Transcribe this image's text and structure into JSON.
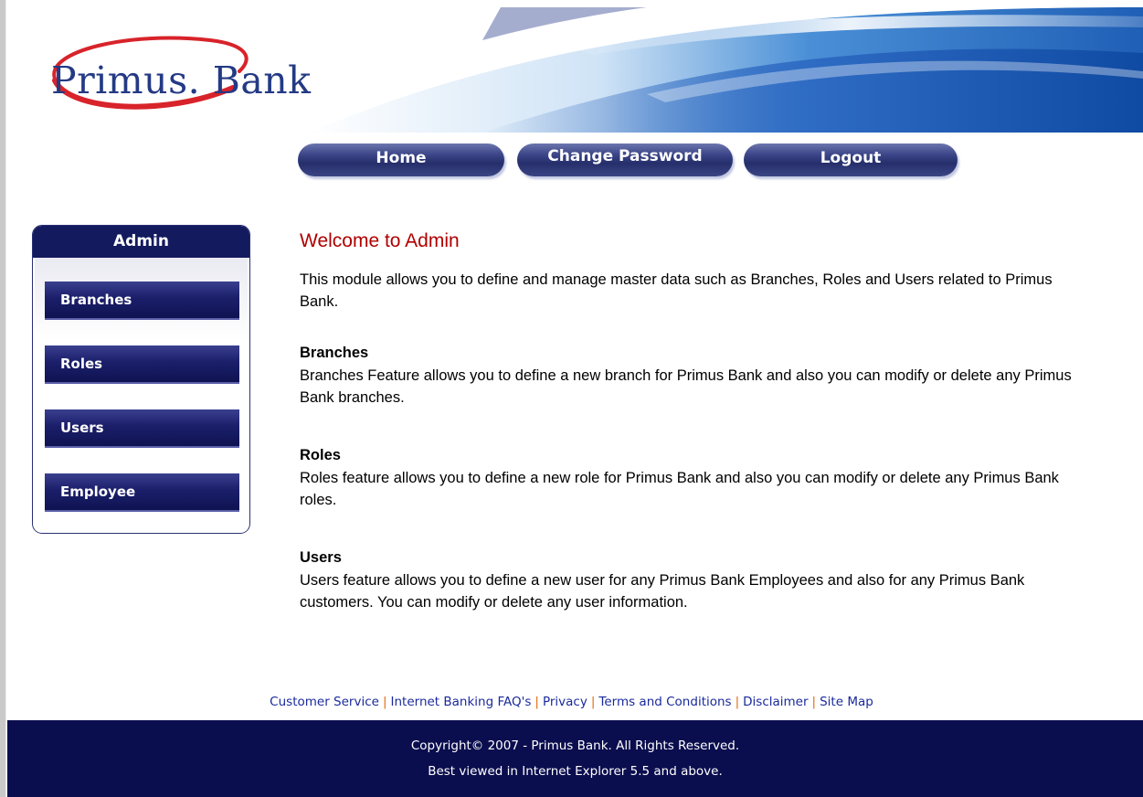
{
  "brand": {
    "name": "Primus. Bank"
  },
  "nav": {
    "home": "Home",
    "change_password": "Change Password",
    "logout": "Logout"
  },
  "sidebar": {
    "title": "Admin",
    "items": [
      {
        "label": "Branches"
      },
      {
        "label": "Roles"
      },
      {
        "label": "Users"
      },
      {
        "label": "Employee"
      }
    ]
  },
  "main": {
    "heading": "Welcome to Admin",
    "intro": "This module allows you to define and manage master data such as Branches, Roles and Users related to Primus Bank.",
    "sections": [
      {
        "title": "Branches",
        "text": "Branches Feature allows you to define a new branch for Primus Bank and also you can modify or delete any Primus Bank branches."
      },
      {
        "title": "Roles",
        "text": "Roles feature allows you to define a new role for Primus Bank and also you can modify or delete any Primus Bank roles."
      },
      {
        "title": "Users",
        "text": "Users feature allows you to define a new user for any Primus Bank Employees and also for any Primus Bank customers. You can modify or delete any user information."
      }
    ]
  },
  "footer": {
    "links": [
      "Customer Service",
      "Internet Banking FAQ's",
      "Privacy",
      "Terms and Conditions",
      "Disclaimer",
      "Site Map"
    ],
    "separator": "|",
    "copyright": "Copyright© 2007 - Primus Bank. All Rights Reserved.",
    "browser_note": "Best viewed in Internet Explorer 5.5 and above."
  },
  "colors": {
    "brand_blue": "#243a85",
    "logo_red": "#d8232a",
    "heading_red": "#b00000",
    "footer_navy": "#0a0d4e",
    "link_blue": "#1a2a9c",
    "separator_orange": "#e26b12"
  }
}
